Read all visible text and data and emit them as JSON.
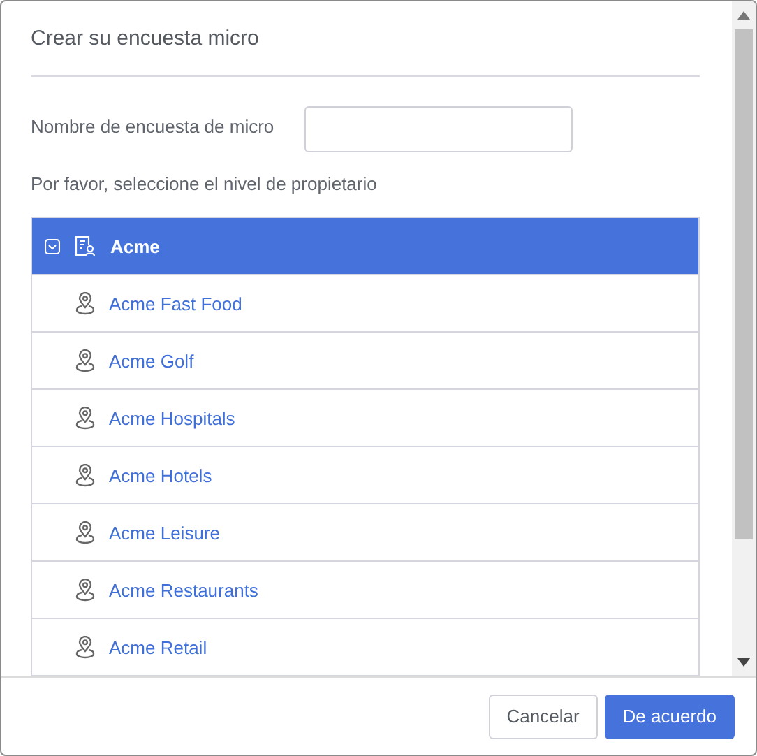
{
  "dialog": {
    "title": "Crear su encuesta micro"
  },
  "name_field": {
    "label": "Nombre de encuesta de micro"
  },
  "owner_prompt": "Por favor, seleccione el nivel de propietario",
  "tree": [
    {
      "label": "Acme",
      "selected": true,
      "expanded": true,
      "children": [
        {
          "label": "Acme Fast Food",
          "selected": false
        },
        {
          "label": "Acme Golf",
          "selected": false
        },
        {
          "label": "Acme Hospitals",
          "selected": false
        },
        {
          "label": "Acme Hotels",
          "selected": false
        },
        {
          "label": "Acme Leisure",
          "selected": false
        },
        {
          "label": "Acme Restaurants",
          "selected": false
        },
        {
          "label": "Acme Retail",
          "selected": false
        }
      ]
    }
  ],
  "buttons": [
    {
      "label": "Cancelar",
      "kind": "secondary"
    },
    {
      "label": "De acuerdo",
      "kind": "primary"
    }
  ]
}
